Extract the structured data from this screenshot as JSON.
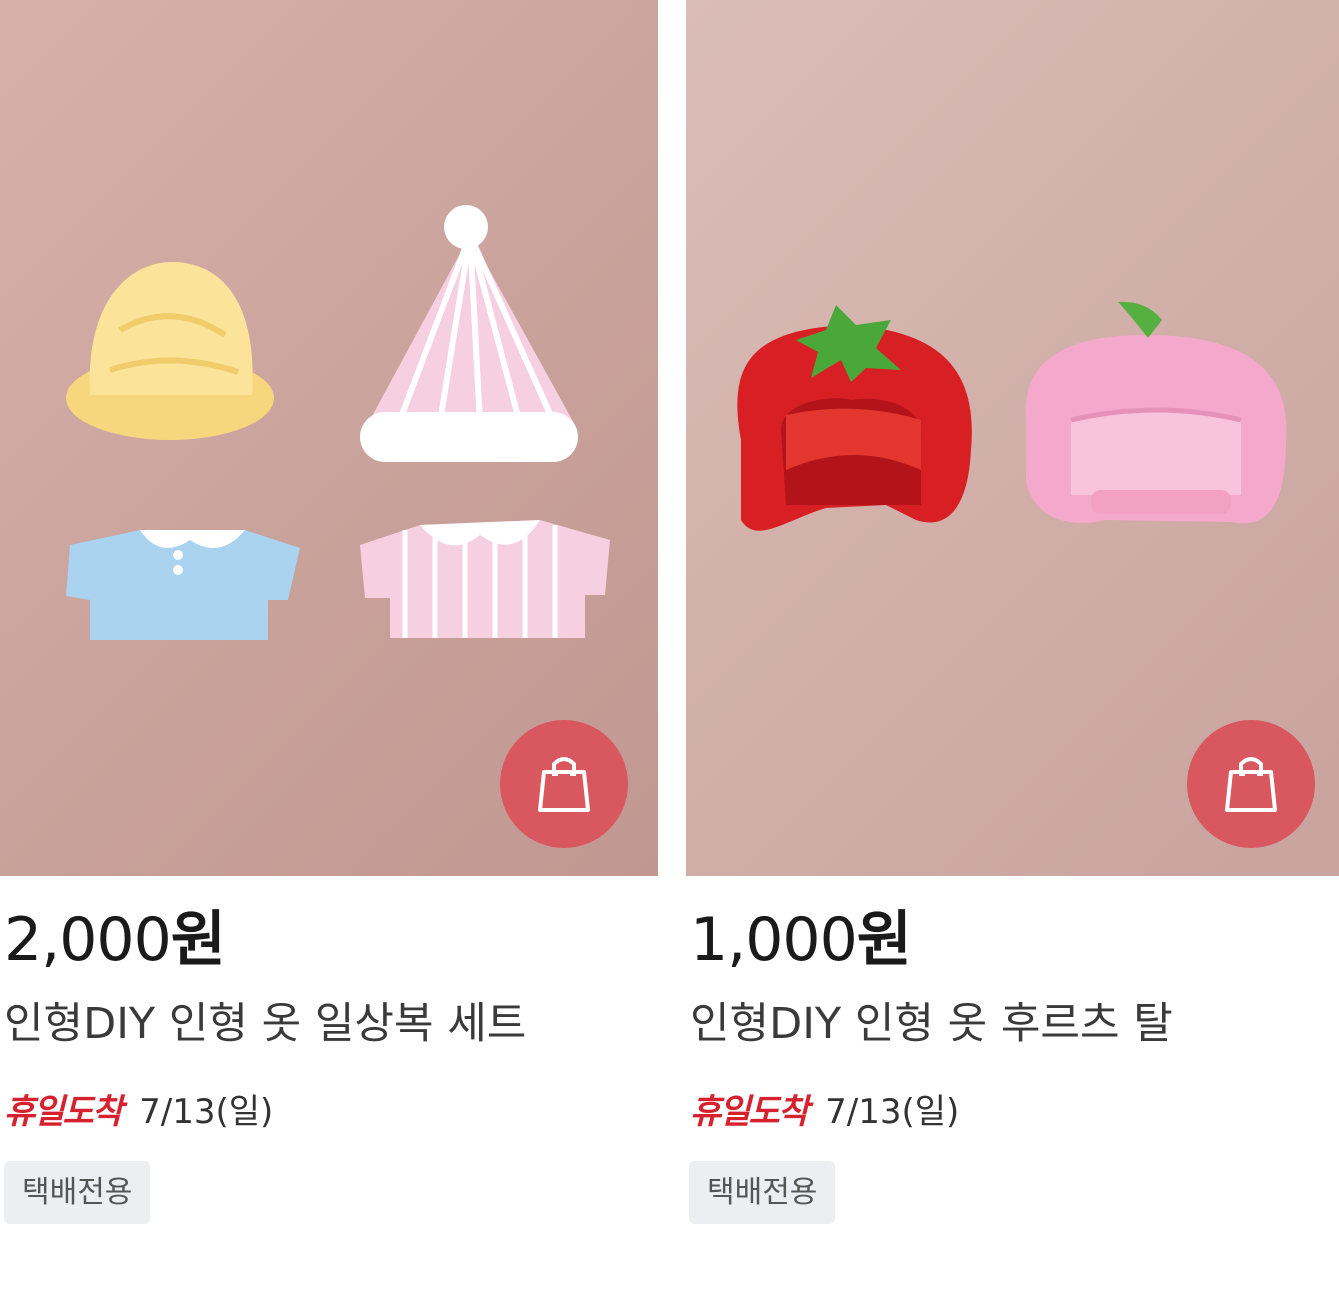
{
  "products": [
    {
      "price_value": "2,000",
      "price_unit": "원",
      "title": "인형DIY 인형 옷 일상복 세트",
      "delivery_badge": "휴일도착",
      "delivery_date": "7/13(일)",
      "tag": "택배전용",
      "image_desc_icons": [
        "bucket-hat-icon",
        "nightcap-icon",
        "blue-shirt-icon",
        "striped-shirt-icon"
      ],
      "cart_icon": "shopping-bag-icon"
    },
    {
      "price_value": "1,000",
      "price_unit": "원",
      "title": "인형DIY 인형 옷 후르츠 탈",
      "delivery_badge": "휴일도착",
      "delivery_date": "7/13(일)",
      "tag": "택배전용",
      "image_desc_icons": [
        "strawberry-hood-icon",
        "peach-hood-icon"
      ],
      "cart_icon": "shopping-bag-icon"
    }
  ],
  "colors": {
    "cart_button": "#d9575f",
    "delivery_badge": "#d6222e",
    "tag_bg": "#eceef1",
    "price_text": "#1a1a1a"
  }
}
